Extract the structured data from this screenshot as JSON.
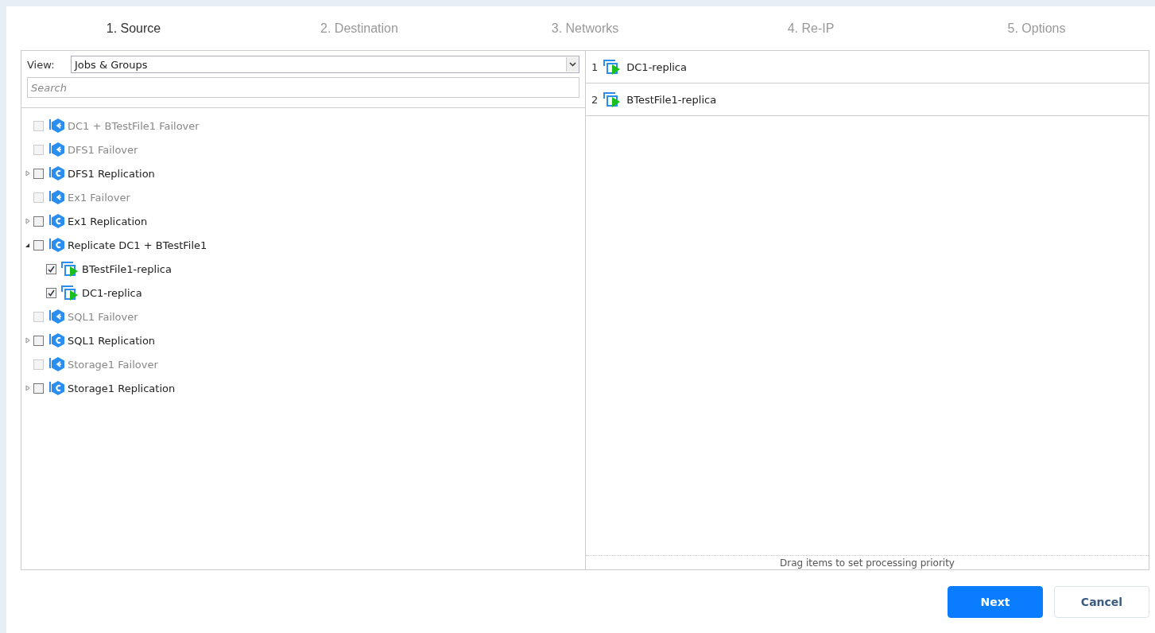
{
  "steps": [
    {
      "label": "1. Source",
      "selected": true
    },
    {
      "label": "2. Destination",
      "selected": false
    },
    {
      "label": "3. Networks",
      "selected": false
    },
    {
      "label": "4. Re-IP",
      "selected": false
    },
    {
      "label": "5. Options",
      "selected": false
    }
  ],
  "view": {
    "label": "View:",
    "value": "Jobs & Groups"
  },
  "search": {
    "placeholder": "Search"
  },
  "tree": [
    {
      "kind": "failover",
      "label": "DC1 + BTestFile1 Failover",
      "disabled": true,
      "checked": false
    },
    {
      "kind": "failover",
      "label": "DFS1 Failover",
      "disabled": true,
      "checked": false
    },
    {
      "kind": "replication",
      "label": "DFS1 Replication",
      "disabled": false,
      "checked": false,
      "expanded": false
    },
    {
      "kind": "failover",
      "label": "Ex1 Failover",
      "disabled": true,
      "checked": false
    },
    {
      "kind": "replication",
      "label": "Ex1 Replication",
      "disabled": false,
      "checked": false,
      "expanded": false
    },
    {
      "kind": "replication",
      "label": "Replicate DC1 + BTestFile1",
      "disabled": false,
      "checked": false,
      "expanded": true,
      "children": [
        {
          "kind": "vm",
          "label": "BTestFile1-replica",
          "disabled": false,
          "checked": true
        },
        {
          "kind": "vm",
          "label": "DC1-replica",
          "disabled": false,
          "checked": true
        }
      ]
    },
    {
      "kind": "failover",
      "label": "SQL1 Failover",
      "disabled": true,
      "checked": false
    },
    {
      "kind": "replication",
      "label": "SQL1 Replication",
      "disabled": false,
      "checked": false,
      "expanded": false
    },
    {
      "kind": "failover",
      "label": "Storage1 Failover",
      "disabled": true,
      "checked": false
    },
    {
      "kind": "replication",
      "label": "Storage1 Replication",
      "disabled": false,
      "checked": false,
      "expanded": false
    }
  ],
  "priority": [
    {
      "index": "1",
      "label": "DC1-replica"
    },
    {
      "index": "2",
      "label": "BTestFile1-replica"
    }
  ],
  "priority_hint": "Drag items to set processing priority",
  "buttons": [
    {
      "kind": "primary",
      "label": "Next"
    },
    {
      "kind": "secondary",
      "label": "Cancel"
    }
  ]
}
